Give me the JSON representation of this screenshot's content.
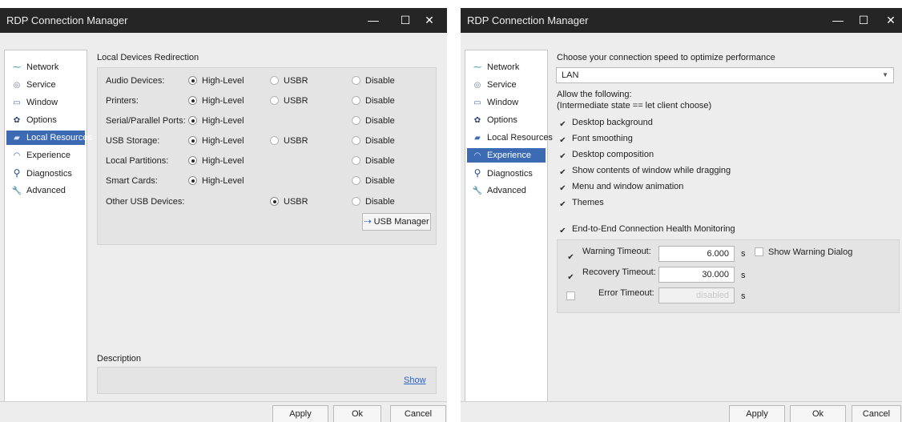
{
  "windows": [
    {
      "title": "RDP Connection Manager",
      "controls": {
        "minimize": "—",
        "maximize": "☐",
        "close": "✕"
      },
      "sidebar": [
        {
          "label": "Network",
          "icon": "network-icon",
          "glyph": "⁓"
        },
        {
          "label": "Service",
          "icon": "service-icon",
          "glyph": "◎"
        },
        {
          "label": "Window",
          "icon": "window-icon",
          "glyph": "▭"
        },
        {
          "label": "Options",
          "icon": "gear-icon",
          "glyph": "✿"
        },
        {
          "label": "Local Resources",
          "icon": "usb-icon",
          "glyph": "▰"
        },
        {
          "label": "Experience",
          "icon": "gauge-icon",
          "glyph": "◠"
        },
        {
          "label": "Diagnostics",
          "icon": "magnifier-icon",
          "glyph": "⚲"
        },
        {
          "label": "Advanced",
          "icon": "wrench-icon",
          "glyph": "🔧"
        }
      ],
      "active_sidebar_index": 4,
      "section_title": "Local Devices Redirection",
      "devices": [
        {
          "name": "Audio Devices:",
          "options": [
            "High-Level",
            "USBR",
            "Disable"
          ],
          "selected": "High-Level"
        },
        {
          "name": "Printers:",
          "options": [
            "High-Level",
            "USBR",
            "Disable"
          ],
          "selected": "High-Level"
        },
        {
          "name": "Serial/Parallel Ports:",
          "options": [
            "High-Level",
            "",
            "Disable"
          ],
          "selected": "High-Level"
        },
        {
          "name": "USB Storage:",
          "options": [
            "High-Level",
            "USBR",
            "Disable"
          ],
          "selected": "High-Level"
        },
        {
          "name": "Local Partitions:",
          "options": [
            "High-Level",
            "",
            "Disable"
          ],
          "selected": "High-Level"
        },
        {
          "name": "Smart Cards:",
          "options": [
            "High-Level",
            "",
            "Disable"
          ],
          "selected": "High-Level"
        },
        {
          "name": "Other USB Devices:",
          "options": [
            "",
            "USBR",
            "Disable"
          ],
          "selected": "USBR"
        }
      ],
      "usb_manager_button": "USB Manager",
      "description_label": "Description",
      "show_link": "Show",
      "buttons": {
        "apply": "Apply",
        "ok": "Ok",
        "cancel": "Cancel"
      }
    },
    {
      "title": "RDP Connection Manager",
      "controls": {
        "minimize": "—",
        "maximize": "☐",
        "close": "✕"
      },
      "sidebar": [
        {
          "label": "Network",
          "icon": "network-icon",
          "glyph": "⁓"
        },
        {
          "label": "Service",
          "icon": "service-icon",
          "glyph": "◎"
        },
        {
          "label": "Window",
          "icon": "window-icon",
          "glyph": "▭"
        },
        {
          "label": "Options",
          "icon": "gear-icon",
          "glyph": "✿"
        },
        {
          "label": "Local Resources",
          "icon": "usb-icon",
          "glyph": "▰"
        },
        {
          "label": "Experience",
          "icon": "gauge-icon",
          "glyph": "◠"
        },
        {
          "label": "Diagnostics",
          "icon": "magnifier-icon",
          "glyph": "⚲"
        },
        {
          "label": "Advanced",
          "icon": "wrench-icon",
          "glyph": "🔧"
        }
      ],
      "active_sidebar_index": 5,
      "speed_label": "Choose your connection speed to optimize performance",
      "speed_value": "LAN",
      "allow_label_1": "Allow the following:",
      "allow_label_2": "(Intermediate state == let client choose)",
      "features": [
        {
          "label": "Desktop background",
          "checked": true
        },
        {
          "label": "Font smoothing",
          "checked": true
        },
        {
          "label": "Desktop composition",
          "checked": true
        },
        {
          "label": "Show contents of window while dragging",
          "checked": true
        },
        {
          "label": "Menu and window animation",
          "checked": true
        },
        {
          "label": "Themes",
          "checked": true
        }
      ],
      "health_label": "End-to-End Connection Health Monitoring",
      "health_checked": true,
      "timeouts": [
        {
          "label": "Warning Timeout:",
          "value": "6.000",
          "unit": "s",
          "checked": true,
          "disabled": false
        },
        {
          "label": "Recovery Timeout:",
          "value": "30.000",
          "unit": "s",
          "checked": true,
          "disabled": false
        },
        {
          "label": "Error Timeout:",
          "value": "disabled",
          "unit": "s",
          "checked": false,
          "disabled": true
        }
      ],
      "show_warning_dialog": {
        "label": "Show Warning Dialog",
        "checked": false
      },
      "buttons": {
        "apply": "Apply",
        "ok": "Ok",
        "cancel": "Cancel"
      }
    }
  ]
}
